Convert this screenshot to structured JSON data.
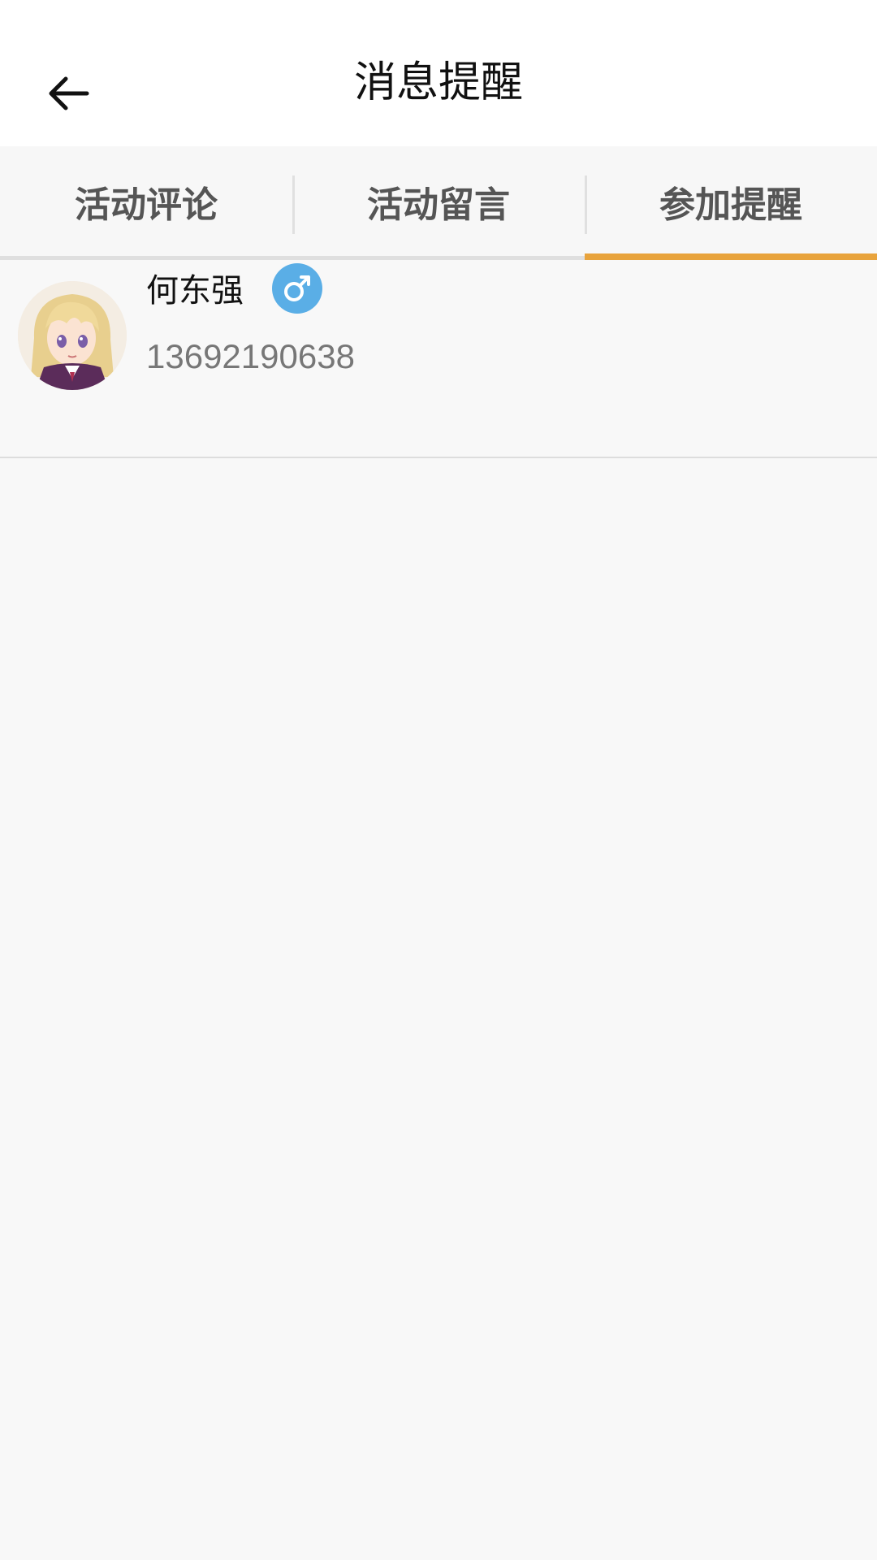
{
  "header": {
    "title": "消息提醒",
    "back_icon": "arrow-left-icon"
  },
  "tabs": [
    {
      "label": "活动评论",
      "active": false
    },
    {
      "label": "活动留言",
      "active": false
    },
    {
      "label": "参加提醒",
      "active": true
    }
  ],
  "colors": {
    "accent": "#e8a33c",
    "gender_male": "#5aaee6",
    "background": "#f8f8f8"
  },
  "list": {
    "items": [
      {
        "name": "何东强",
        "gender_icon": "male-icon",
        "phone": "13692190638",
        "avatar_icon": "anime-girl-avatar"
      }
    ]
  }
}
